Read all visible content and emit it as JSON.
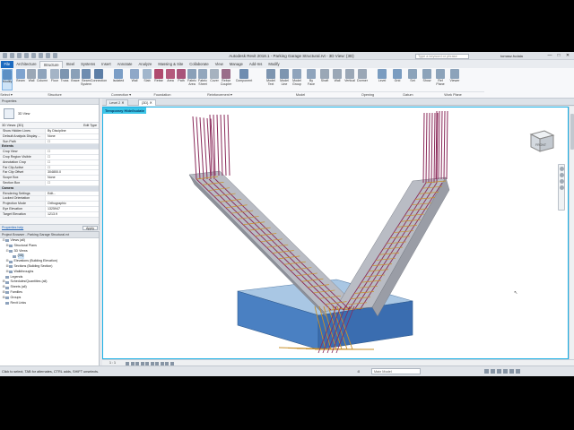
{
  "window": {
    "title": "Autodesk Revit 2018.1 - Parking Garage Structural.rvt - 3D View: {3D}",
    "search_placeholder": "Type a keyword or phrase",
    "user": "tomasz.fudala",
    "controls": [
      "—",
      "□",
      "✕"
    ]
  },
  "ribbon_tabs": [
    "File",
    "Architecture",
    "Structure",
    "Steel",
    "Systems",
    "Insert",
    "Annotate",
    "Analyze",
    "Massing & Site",
    "Collaborate",
    "View",
    "Manage",
    "Add-Ins",
    "Modify"
  ],
  "active_tab": "Structure",
  "ribbon": {
    "buttons": [
      "Modify",
      "Beam",
      "Wall",
      "Column",
      "Floor",
      "Truss",
      "Brace",
      "Beam System",
      "Connection",
      "Isolated",
      "Wall",
      "Slab",
      "Rebar",
      "Area",
      "Path",
      "Fabric Area",
      "Fabric Sheet",
      "Cover",
      "Rebar Coupler",
      "Component",
      "Model Text",
      "Model Line",
      "Model Group",
      "By Face",
      "Shaft",
      "Wall",
      "Vertical",
      "Dormer",
      "Level",
      "Grid",
      "Set",
      "Show",
      "Ref Plane",
      "Viewer"
    ],
    "panels": [
      "Select ▾",
      "Structure",
      "Connection ▾",
      "Foundation",
      "Reinforcement ▾",
      "Model",
      "Opening",
      "Datum",
      "Work Plane"
    ]
  },
  "view_tabs": [
    "Level 2",
    "{3D}"
  ],
  "active_view_tab": "{3D}",
  "properties": {
    "header": "Properties",
    "type_name": "3D View",
    "dropdown": "3D Views: {3D}",
    "edit_type": "Edit Type",
    "rows": [
      {
        "k": "Show Hidden Lines",
        "v": "By Discipline"
      },
      {
        "k": "Default Analysis Display ...",
        "v": "None"
      },
      {
        "k": "Sun Path",
        "v": "☐"
      },
      {
        "cat": "Extents"
      },
      {
        "k": "Crop View",
        "v": "☐"
      },
      {
        "k": "Crop Region Visible",
        "v": "☐"
      },
      {
        "k": "Annotation Crop",
        "v": "☐"
      },
      {
        "k": "Far Clip Active",
        "v": "☐"
      },
      {
        "k": "Far Clip Offset",
        "v": "304800.0"
      },
      {
        "k": "Scope Box",
        "v": "None"
      },
      {
        "k": "Section Box",
        "v": "☐"
      },
      {
        "cat": "Camera"
      },
      {
        "k": "Rendering Settings",
        "v": "Edit..."
      },
      {
        "k": "Locked Orientation",
        "v": ""
      },
      {
        "k": "Projection Mode",
        "v": "Orthographic"
      },
      {
        "k": "Eye Elevation",
        "v": "1325947"
      },
      {
        "k": "Target Elevation",
        "v": "1213.9"
      }
    ],
    "help_link": "Properties help",
    "apply": "Apply"
  },
  "browser": {
    "header": "Project Browser - Parking Garage Structural.rvt",
    "items": [
      {
        "t": "⊟",
        "label": "Views (all)",
        "lvl": 0
      },
      {
        "t": "⊞",
        "label": "Structural Plans",
        "lvl": 1
      },
      {
        "t": "⊟",
        "label": "3D Views",
        "lvl": 1
      },
      {
        "t": "",
        "label": "{3D}",
        "lvl": 2,
        "sel": true
      },
      {
        "t": "⊞",
        "label": "Elevations (Building Elevation)",
        "lvl": 1
      },
      {
        "t": "⊞",
        "label": "Sections (Building Section)",
        "lvl": 1
      },
      {
        "t": "⊞",
        "label": "Walkthroughs",
        "lvl": 1
      },
      {
        "t": "",
        "label": "Legends",
        "lvl": 0
      },
      {
        "t": "⊞",
        "label": "Schedules/Quantities (all)",
        "lvl": 0
      },
      {
        "t": "⊞",
        "label": "Sheets (all)",
        "lvl": 0
      },
      {
        "t": "⊞",
        "label": "Families",
        "lvl": 0
      },
      {
        "t": "⊞",
        "label": "Groups",
        "lvl": 0
      },
      {
        "t": "",
        "label": "Revit Links",
        "lvl": 0
      }
    ]
  },
  "viewport": {
    "temp_mode": "Temporary Hide/Isolate",
    "view_cube_label": "FRONT",
    "scale": "1 : 1"
  },
  "status": {
    "message": "Click to select, TAB for alternates, CTRL adds, SHIFT unselects.",
    "model": "Main Model",
    "workset_value": ":0"
  },
  "colors": {
    "accent": "#1b6ac0",
    "rebar_main": "#8a2a5a",
    "rebar_ties": "#c8902a",
    "concrete": "#b9bcc4",
    "footing_top": "#a9c7e4",
    "footing_side": "#4a80c2",
    "temp_border": "#1ab0e6"
  }
}
